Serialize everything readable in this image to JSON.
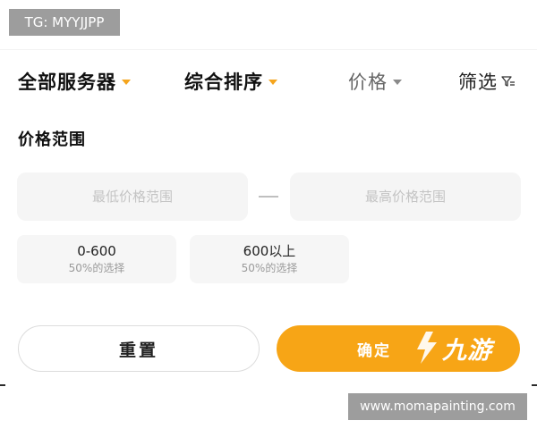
{
  "watermark_top": "TG: MYYJJPP",
  "filter_bar": {
    "items": [
      {
        "label": "全部服务器",
        "active": true
      },
      {
        "label": "综合排序",
        "active": true
      },
      {
        "label": "价格",
        "active": false
      },
      {
        "label": "筛选",
        "active": false
      }
    ]
  },
  "price_section": {
    "title": "价格范围",
    "min_placeholder": "最低价格范围",
    "max_placeholder": "最高价格范围",
    "min_value": "",
    "max_value": "",
    "options": [
      {
        "range": "0-600",
        "note": "50%的选择"
      },
      {
        "range": "600以上",
        "note": "50%的选择"
      }
    ]
  },
  "actions": {
    "reset_label": "重置",
    "confirm_label": "确定"
  },
  "logo": {
    "text": "九游"
  },
  "watermark_bottom": "www.momapainting.com",
  "colors": {
    "accent": "#f7a516",
    "caret_active": "#f5a51d",
    "input_bg": "#f5f5f5"
  }
}
